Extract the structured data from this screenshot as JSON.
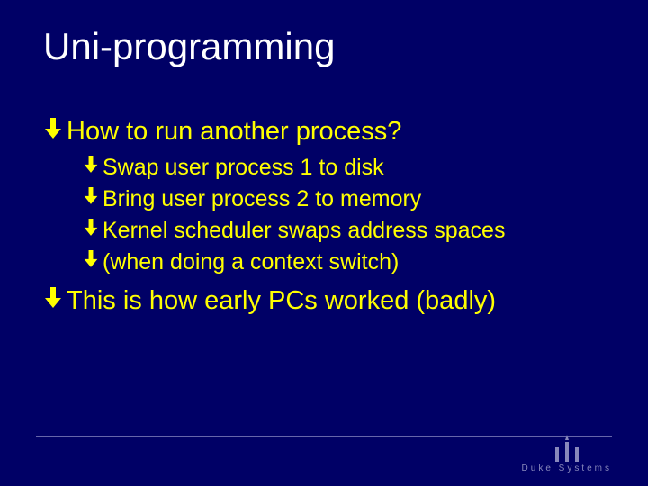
{
  "title": "Uni-programming",
  "bullets": [
    {
      "text": "How to run another process?",
      "sub": [
        "Swap user process 1 to disk",
        "Bring user process 2 to memory",
        "Kernel scheduler swaps address spaces",
        "(when doing a context switch)"
      ]
    },
    {
      "text": "This is how early PCs worked (badly)",
      "sub": []
    }
  ],
  "footer_brand": "Duke Systems",
  "colors": {
    "bg": "#000066",
    "title": "#ffffff",
    "body": "#ffff00",
    "accent": "#8888bb"
  }
}
